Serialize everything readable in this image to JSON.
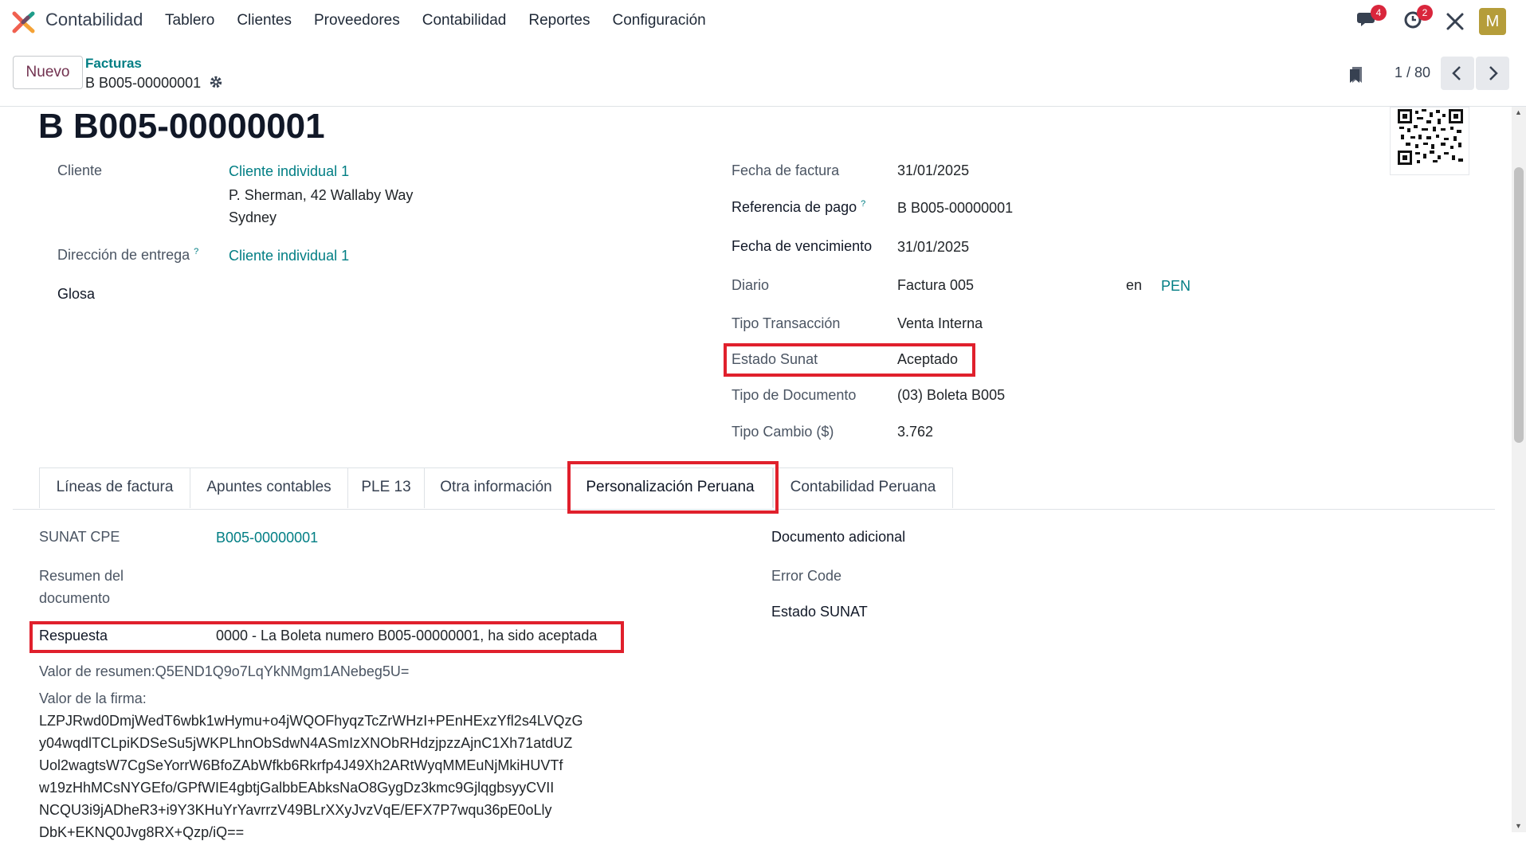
{
  "topnav": {
    "app_name": "Contabilidad",
    "menu": [
      "Tablero",
      "Clientes",
      "Proveedores",
      "Contabilidad",
      "Reportes",
      "Configuración"
    ],
    "chat_badge": "4",
    "activity_badge": "2",
    "avatar_letter": "M"
  },
  "controlbar": {
    "new_button": "Nuevo",
    "breadcrumb_parent": "Facturas",
    "breadcrumb_current": "B B005-00000001",
    "pager": "1 / 80"
  },
  "form": {
    "title": "B B005-00000001",
    "left": {
      "cliente_label": "Cliente",
      "cliente_value": "Cliente individual 1",
      "address_line1": "P. Sherman, 42 Wallaby Way",
      "address_line2": "Sydney",
      "delivery_label": "Dirección de entrega",
      "delivery_help": "?",
      "delivery_value": "Cliente individual 1",
      "glosa_label": "Glosa"
    },
    "right": {
      "fecha_factura_label": "Fecha de factura",
      "fecha_factura_value": "31/01/2025",
      "ref_pago_label": "Referencia de pago",
      "ref_pago_help": "?",
      "ref_pago_value": "B B005-00000001",
      "vencimiento_label": "Fecha de vencimiento",
      "vencimiento_value": "31/01/2025",
      "diario_label": "Diario",
      "diario_value": "Factura 005",
      "currency_prefix": "en",
      "currency_value": "PEN",
      "tipo_tx_label": "Tipo Transacción",
      "tipo_tx_value": "Venta Interna",
      "estado_sunat_label": "Estado Sunat",
      "estado_sunat_value": "Aceptado",
      "tipo_doc_label": "Tipo de Documento",
      "tipo_doc_value": "(03) Boleta B005",
      "tipo_cambio_label": "Tipo Cambio ($)",
      "tipo_cambio_value": "3.762"
    }
  },
  "tabs": [
    "Líneas de factura",
    "Apuntes contables",
    "PLE 13",
    "Otra información",
    "Personalización Peruana",
    "Contabilidad Peruana"
  ],
  "tab_content": {
    "sunat_cpe_label": "SUNAT CPE",
    "sunat_cpe_value": "B005-00000001",
    "resumen_label_1": "Resumen del",
    "resumen_label_2": "documento",
    "respuesta_label": "Respuesta",
    "respuesta_value": "0000 - La Boleta numero B005-00000001, ha sido aceptada",
    "valor_resumen": "Valor de resumen:Q5END1Q9o7LqYkNMgm1ANebeg5U=",
    "valor_firma_label": "Valor de la firma:",
    "firma_lines": [
      "LZPJRwd0DmjWedT6wbk1wHymu+o4jWQOFhyqzTcZrWHzI+PEnHExzYfl2s4LVQzG",
      "y04wqdlTCLpiKDSeSu5jWKPLhnObSdwN4ASmIzXNObRHdzjpzzAjnC1Xh71atdUZ",
      "Uol2wagtsW7CgSeYorrW6BfoZAbWfkb6Rkrfp4J49Xh2ARtWyqMMEuNjMkiHUVTf",
      "w19zHhMCsNYGEfo/GPfWIE4gbtjGalbbEAbksNaO8GygDz3kmc9GjlqgbsyyCVII",
      "NCQU3i9jADheR3+i9Y3KHuYrYavrrzV49BLrXXyJvzVqE/EFX7P7wqu36pE0oLly",
      "DbK+EKNQ0Jvg8RX+Qzp/iQ=="
    ],
    "doc_adicional_label": "Documento adicional",
    "error_code_label": "Error Code",
    "estado_sunat_label": "Estado SUNAT"
  }
}
